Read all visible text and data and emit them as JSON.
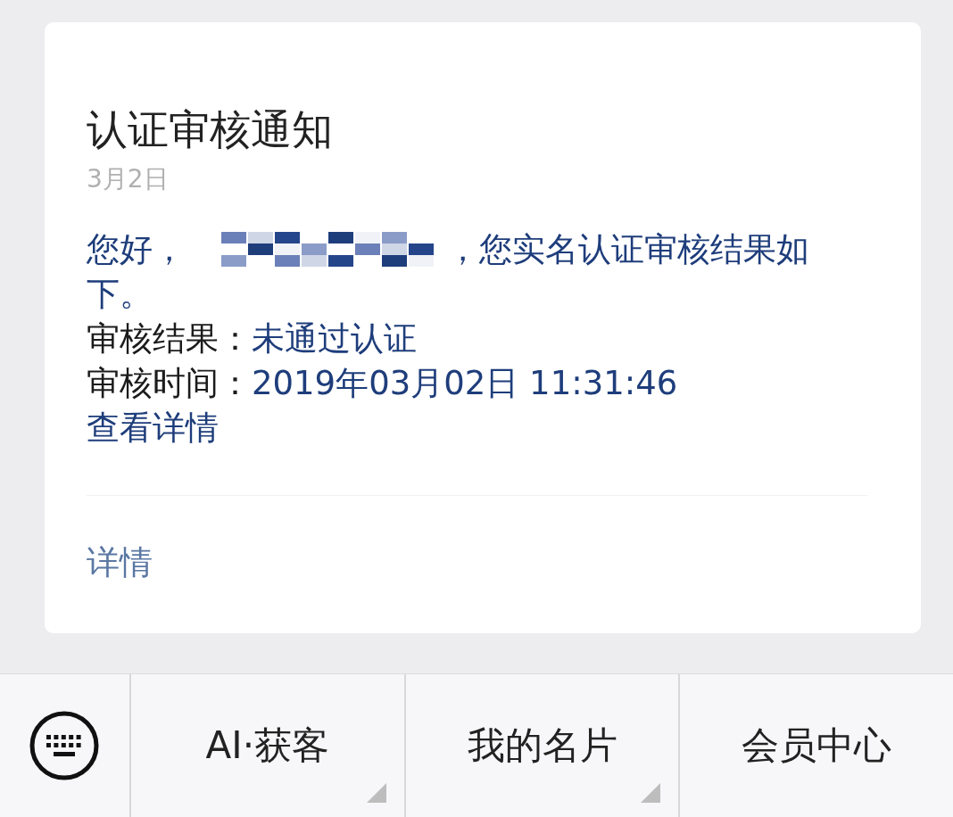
{
  "card": {
    "title": "认证审核通知",
    "date": "3月2日",
    "greeting": "您好，",
    "greeting_rest": [
      "，您实名认证审核结果如",
      "下。"
    ],
    "fields": [
      {
        "label": "审核结果：",
        "value": "未通过认证"
      },
      {
        "label": "审核时间：",
        "value": "2019年03月02日 11:31:46"
      }
    ],
    "link": "查看详情",
    "footer_link": "详情"
  },
  "menu_bar": {
    "items": [
      {
        "label": "AI·获客",
        "has_submenu": true
      },
      {
        "label": "我的名片",
        "has_submenu": true
      },
      {
        "label": "会员中心",
        "has_submenu": false
      }
    ]
  }
}
